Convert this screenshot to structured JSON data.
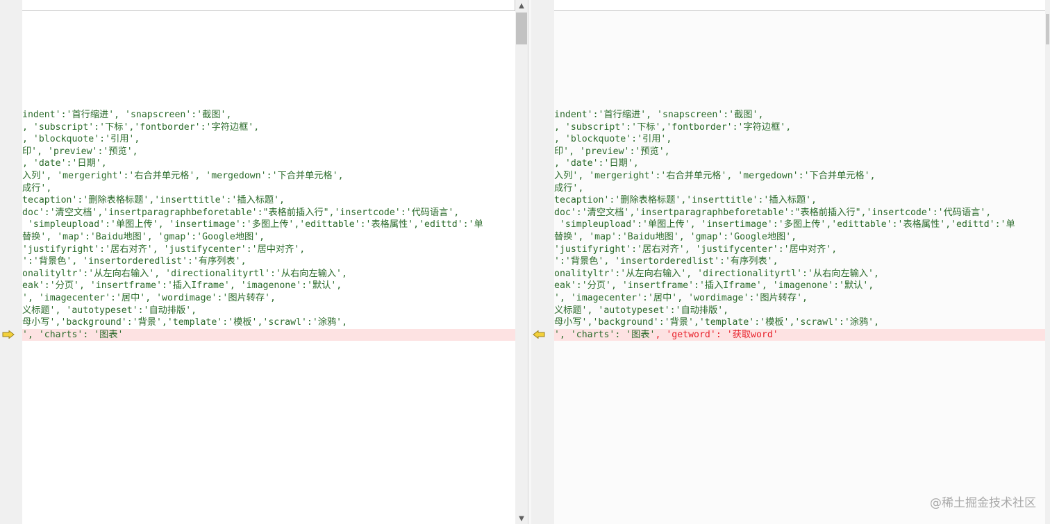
{
  "left_pane": {
    "lines": [
      "indent':'首行缩进', 'snapscreen':'截图',",
      ", 'subscript':'下标','fontborder':'字符边框',",
      ", 'blockquote':'引用',",
      "印', 'preview':'预览',",
      ", 'date':'日期',",
      "入列', 'mergeright':'右合并单元格', 'mergedown':'下合并单元格',",
      "成行',",
      "tecaption':'删除表格标题','inserttitle':'插入标题',",
      "doc':'清空文档','insertparagraphbeforetable':\"表格前插入行\",'insertcode':'代码语言',",
      " 'simpleupload':'单图上传', 'insertimage':'多图上传','edittable':'表格属性','edittd':'单",
      "替换', 'map':'Baidu地图', 'gmap':'Google地图',",
      "'justifyright':'居右对齐', 'justifycenter':'居中对齐',",
      "':'背景色', 'insertorderedlist':'有序列表',",
      "onalityltr':'从左向右输入', 'directionalityrtl':'从右向左输入',",
      "eak':'分页', 'insertframe':'插入Iframe', 'imagenone':'默认',",
      "', 'imagecenter':'居中', 'wordimage':'图片转存',",
      "义标题', 'autotypeset':'自动排版',",
      "母小写','background':'背景','template':'模板','scrawl':'涂鸦',"
    ],
    "changed_line": "', 'charts': '图表'"
  },
  "right_pane": {
    "lines": [
      "indent':'首行缩进', 'snapscreen':'截图',",
      ", 'subscript':'下标','fontborder':'字符边框',",
      ", 'blockquote':'引用',",
      "印', 'preview':'预览',",
      ", 'date':'日期',",
      "入列', 'mergeright':'右合并单元格', 'mergedown':'下合并单元格',",
      "成行',",
      "tecaption':'删除表格标题','inserttitle':'插入标题',",
      "doc':'清空文档','insertparagraphbeforetable':\"表格前插入行\",'insertcode':'代码语言',",
      " 'simpleupload':'单图上传', 'insertimage':'多图上传','edittable':'表格属性','edittd':'单",
      "替换', 'map':'Baidu地图', 'gmap':'Google地图',",
      "'justifyright':'居右对齐', 'justifycenter':'居中对齐',",
      "':'背景色', 'insertorderedlist':'有序列表',",
      "onalityltr':'从左向右输入', 'directionalityrtl':'从右向左输入',",
      "eak':'分页', 'insertframe':'插入Iframe', 'imagenone':'默认',",
      "', 'imagecenter':'居中', 'wordimage':'图片转存',",
      "义标题', 'autotypeset':'自动排版',",
      "母小写','background':'背景','template':'模板','scrawl':'涂鸦',"
    ],
    "changed_line_common": "', 'charts': '图表'",
    "changed_line_sep": ", ",
    "changed_line_added": "'getword': '获取word'"
  },
  "icons": {
    "left_marker": "arrow-right-icon",
    "right_marker": "arrow-left-icon",
    "scroll_up": "chevron-up-icon",
    "scroll_down": "chevron-down-icon"
  },
  "colors": {
    "code_text": "#2a6a2a",
    "diff_added": "#e8212b",
    "diff_line_bg": "#fde2e2",
    "marker_fill": "#f2d03a"
  },
  "watermark": "@稀土掘金技术社区"
}
